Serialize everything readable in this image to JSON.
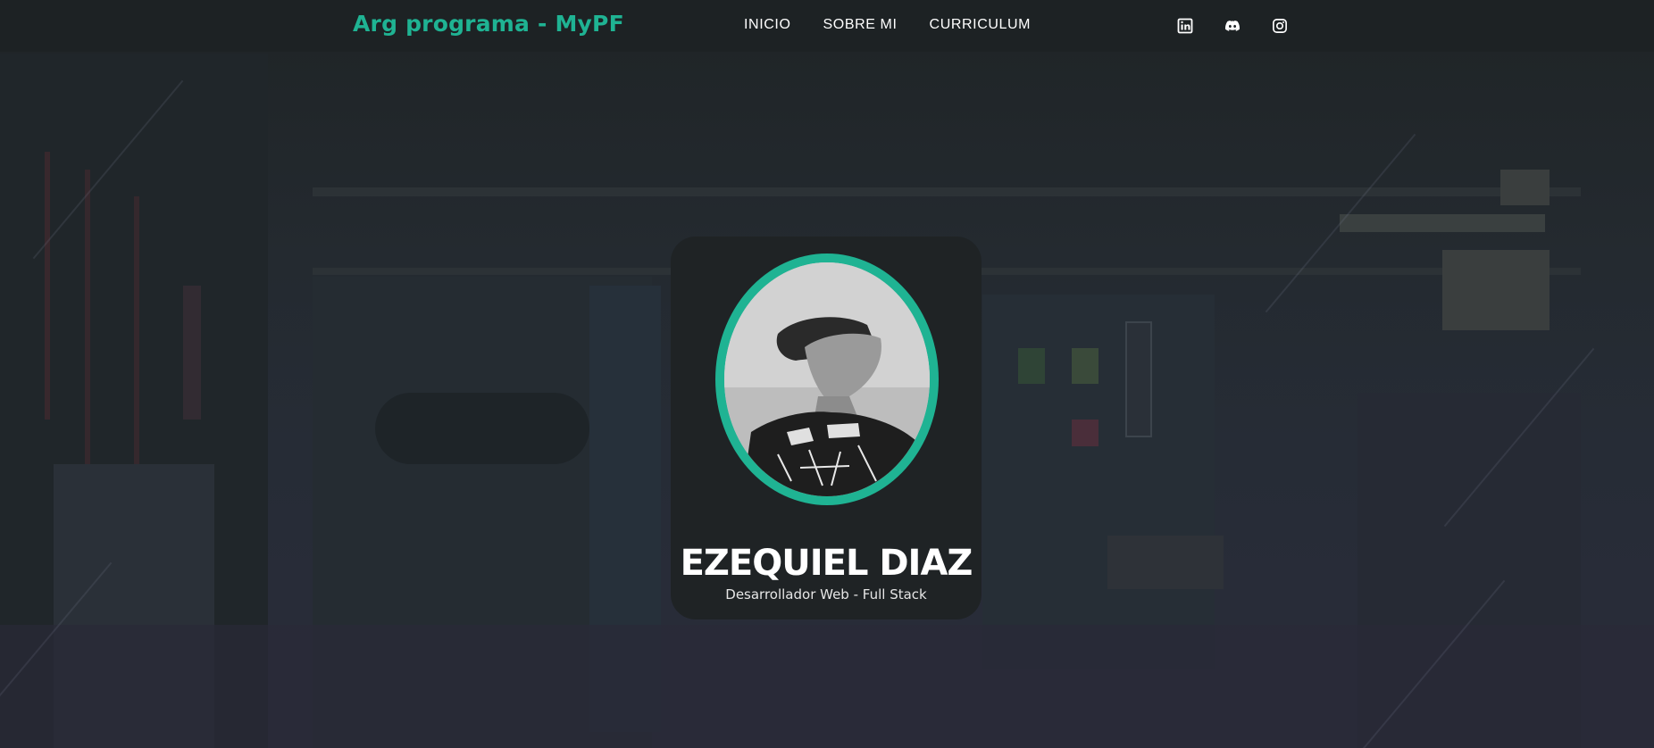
{
  "navbar": {
    "brand": "Arg programa - MyPF",
    "links": [
      {
        "label": "INICIO"
      },
      {
        "label": "SOBRE MI"
      },
      {
        "label": "CURRICULUM"
      }
    ],
    "social": [
      {
        "icon": "linkedin-icon"
      },
      {
        "icon": "discord-icon"
      },
      {
        "icon": "instagram-icon"
      }
    ]
  },
  "profile": {
    "name": "EZEQUIEL DIAZ",
    "role": "Desarrollador Web - Full Stack"
  },
  "colors": {
    "accent": "#1fb393",
    "navbar_bg": "#1d2224",
    "card_bg": "#1f2325",
    "text": "#ffffff"
  }
}
